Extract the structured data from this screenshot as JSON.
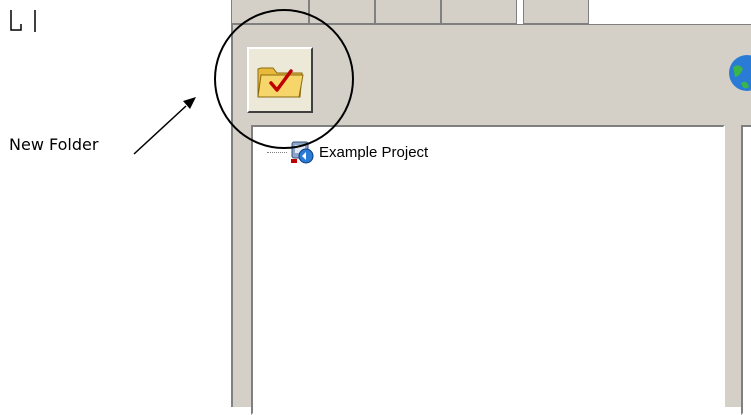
{
  "annotation": {
    "label": "New Folder"
  },
  "toolbar": {
    "new_folder_button": {
      "icon": "folder-check-icon"
    },
    "globe_button": {
      "icon": "globe-icon"
    }
  },
  "tree": {
    "items": [
      {
        "label": "Example Project",
        "icon": "project-icon"
      }
    ]
  },
  "colors": {
    "window_bg": "#d4d0c8",
    "panel_bg": "#ffffff",
    "folder": "#f6d66b",
    "check": "#c00000"
  }
}
